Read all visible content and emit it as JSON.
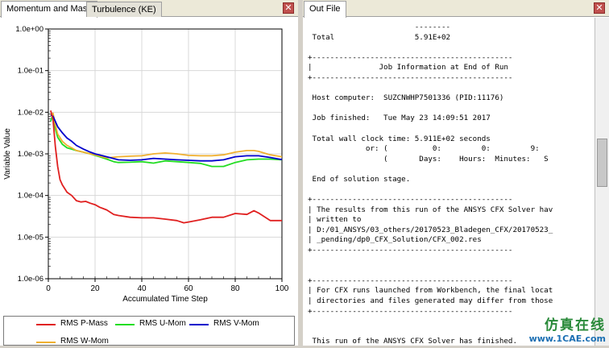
{
  "left_panel": {
    "tabs": [
      {
        "label": "Momentum and Mass",
        "active": true
      },
      {
        "label": "Turbulence (KE)",
        "active": false
      }
    ],
    "close_glyph": "✕"
  },
  "right_panel": {
    "tabs": [
      {
        "label": "Out File",
        "active": true
      }
    ],
    "close_glyph": "✕",
    "lines": [
      "                        --------",
      " Total                  5.91E+02",
      "",
      "+---------------------------------------------",
      "|               Job Information at End of Run",
      "+---------------------------------------------",
      "",
      " Host computer:  SUZCNWHP7501336 (PID:11176)",
      "",
      " Job finished:   Tue May 23 14:09:51 2017",
      "",
      " Total wall clock time: 5.911E+02 seconds",
      "             or: (          0:         0:         9:",
      "                 (       Days:    Hours:  Minutes:   S",
      "",
      " End of solution stage.",
      "",
      "+---------------------------------------------",
      "| The results from this run of the ANSYS CFX Solver hav",
      "| written to",
      "| D:/01_ANSYS/03_others/20170523_Bladegen_CFX/20170523_",
      "| _pending/dp0_CFX_Solution/CFX_002.res",
      "+---------------------------------------------",
      "",
      "",
      "+---------------------------------------------",
      "| For CFX runs launched from Workbench, the final locat",
      "| directories and files generated may differ from those",
      "+---------------------------------------------",
      "",
      "",
      " This run of the ANSYS CFX Solver has finished."
    ]
  },
  "watermark": {
    "cn": "仿真在线",
    "url": "www.1CAE.com"
  },
  "colors": {
    "p_mass": "#e02020",
    "u_mom": "#22dd22",
    "v_mom": "#0000cc",
    "w_mom": "#f0b030"
  },
  "chart_data": {
    "type": "line",
    "xlabel": "Accumulated Time Step",
    "ylabel": "Variable Value",
    "x_ticks": [
      0,
      20,
      40,
      60,
      80,
      100
    ],
    "x_tick_labels": [
      "0",
      "20",
      "40",
      "60",
      "80",
      "100"
    ],
    "y_scale": "log",
    "y_ticks": [
      1e-06,
      1e-05,
      0.0001,
      0.001,
      0.01,
      0.1,
      1
    ],
    "y_tick_labels": [
      "1.0e-06",
      "1.0e-05",
      "1.0e-04",
      "1.0e-03",
      "1.0e-02",
      "1.0e-01",
      "1.0e+00"
    ],
    "xlim": [
      0,
      100
    ],
    "ylim": [
      1e-06,
      1
    ],
    "grid": true,
    "legend_position": "bottom",
    "series": [
      {
        "name": "RMS P-Mass",
        "color": "#e02020",
        "x": [
          1,
          2,
          3,
          4,
          5,
          6,
          8,
          10,
          12,
          14,
          16,
          18,
          20,
          22,
          25,
          28,
          30,
          35,
          40,
          45,
          50,
          55,
          58,
          60,
          65,
          70,
          75,
          80,
          85,
          88,
          90,
          95,
          100
        ],
        "y": [
          0.011,
          0.0068,
          0.0015,
          0.0005,
          0.00024,
          0.00018,
          0.00012,
          0.0001,
          7.5e-05,
          7e-05,
          7.2e-05,
          6.5e-05,
          6e-05,
          5.2e-05,
          4.5e-05,
          3.5e-05,
          3.3e-05,
          3e-05,
          2.9e-05,
          2.9e-05,
          2.7e-05,
          2.5e-05,
          2.2e-05,
          2.3e-05,
          2.6e-05,
          3e-05,
          3e-05,
          3.7e-05,
          3.5e-05,
          4.3e-05,
          3.8e-05,
          2.5e-05,
          2.5e-05
        ]
      },
      {
        "name": "RMS U-Mom",
        "color": "#22dd22",
        "x": [
          1,
          2,
          3,
          4,
          6,
          8,
          10,
          12,
          15,
          18,
          20,
          22,
          25,
          28,
          30,
          35,
          40,
          45,
          50,
          55,
          60,
          65,
          70,
          75,
          80,
          85,
          90,
          95,
          100
        ],
        "y": [
          0.006,
          0.009,
          0.004,
          0.0025,
          0.0017,
          0.0014,
          0.0013,
          0.0012,
          0.0011,
          0.001,
          0.00092,
          0.00085,
          0.00075,
          0.00065,
          0.00062,
          0.00063,
          0.00065,
          0.0006,
          0.00068,
          0.00065,
          0.00062,
          0.00059,
          0.0005,
          0.0005,
          0.00062,
          0.00072,
          0.00075,
          0.00075,
          0.00072
        ]
      },
      {
        "name": "RMS V-Mom",
        "color": "#0000cc",
        "x": [
          1,
          2,
          3,
          4,
          6,
          8,
          10,
          12,
          15,
          18,
          20,
          25,
          30,
          35,
          40,
          45,
          50,
          55,
          60,
          65,
          70,
          75,
          80,
          85,
          90,
          95,
          100
        ],
        "y": [
          0.0085,
          0.008,
          0.006,
          0.0045,
          0.0032,
          0.0024,
          0.002,
          0.0016,
          0.0013,
          0.0011,
          0.001,
          0.00085,
          0.00072,
          0.0007,
          0.00072,
          0.00078,
          0.00075,
          0.00072,
          0.0007,
          0.00068,
          0.00068,
          0.00072,
          0.00085,
          0.0009,
          0.0009,
          0.00082,
          0.00073
        ]
      },
      {
        "name": "RMS W-Mom",
        "color": "#f0b030",
        "x": [
          1,
          2,
          3,
          4,
          6,
          8,
          10,
          12,
          15,
          18,
          20,
          25,
          30,
          35,
          40,
          45,
          50,
          55,
          60,
          65,
          70,
          75,
          80,
          85,
          88,
          90,
          95,
          100
        ],
        "y": [
          0.0085,
          0.0095,
          0.005,
          0.003,
          0.002,
          0.0016,
          0.0014,
          0.0012,
          0.0011,
          0.001,
          0.00095,
          0.0008,
          0.00085,
          0.00088,
          0.0009,
          0.001,
          0.00105,
          0.001,
          0.00092,
          0.0009,
          0.0009,
          0.00095,
          0.0011,
          0.0012,
          0.0012,
          0.00115,
          0.00095,
          0.00085
        ]
      }
    ]
  }
}
